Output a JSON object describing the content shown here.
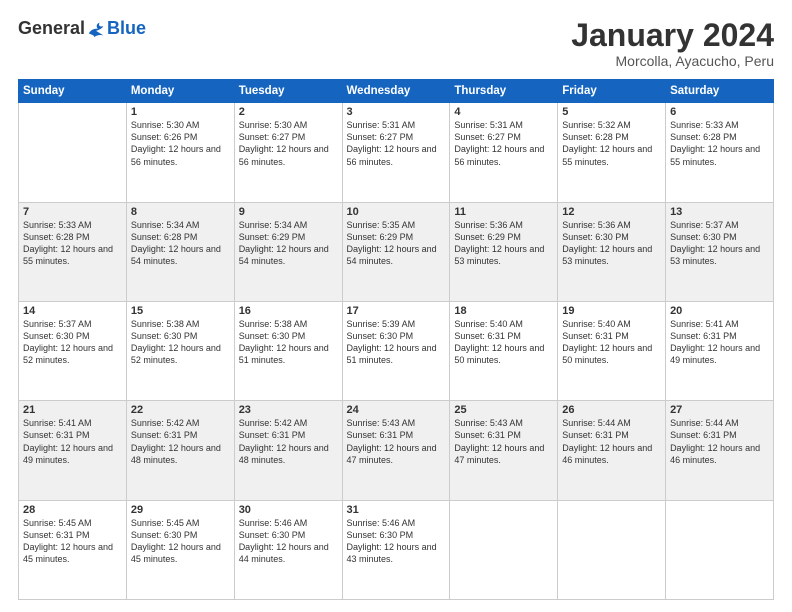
{
  "logo": {
    "general": "General",
    "blue": "Blue"
  },
  "header": {
    "title": "January 2024",
    "subtitle": "Morcolla, Ayacucho, Peru"
  },
  "weekdays": [
    "Sunday",
    "Monday",
    "Tuesday",
    "Wednesday",
    "Thursday",
    "Friday",
    "Saturday"
  ],
  "weeks": [
    [
      {
        "day": "",
        "sunrise": "",
        "sunset": "",
        "daylight": ""
      },
      {
        "day": "1",
        "sunrise": "Sunrise: 5:30 AM",
        "sunset": "Sunset: 6:26 PM",
        "daylight": "Daylight: 12 hours and 56 minutes."
      },
      {
        "day": "2",
        "sunrise": "Sunrise: 5:30 AM",
        "sunset": "Sunset: 6:27 PM",
        "daylight": "Daylight: 12 hours and 56 minutes."
      },
      {
        "day": "3",
        "sunrise": "Sunrise: 5:31 AM",
        "sunset": "Sunset: 6:27 PM",
        "daylight": "Daylight: 12 hours and 56 minutes."
      },
      {
        "day": "4",
        "sunrise": "Sunrise: 5:31 AM",
        "sunset": "Sunset: 6:27 PM",
        "daylight": "Daylight: 12 hours and 56 minutes."
      },
      {
        "day": "5",
        "sunrise": "Sunrise: 5:32 AM",
        "sunset": "Sunset: 6:28 PM",
        "daylight": "Daylight: 12 hours and 55 minutes."
      },
      {
        "day": "6",
        "sunrise": "Sunrise: 5:33 AM",
        "sunset": "Sunset: 6:28 PM",
        "daylight": "Daylight: 12 hours and 55 minutes."
      }
    ],
    [
      {
        "day": "7",
        "sunrise": "Sunrise: 5:33 AM",
        "sunset": "Sunset: 6:28 PM",
        "daylight": "Daylight: 12 hours and 55 minutes."
      },
      {
        "day": "8",
        "sunrise": "Sunrise: 5:34 AM",
        "sunset": "Sunset: 6:28 PM",
        "daylight": "Daylight: 12 hours and 54 minutes."
      },
      {
        "day": "9",
        "sunrise": "Sunrise: 5:34 AM",
        "sunset": "Sunset: 6:29 PM",
        "daylight": "Daylight: 12 hours and 54 minutes."
      },
      {
        "day": "10",
        "sunrise": "Sunrise: 5:35 AM",
        "sunset": "Sunset: 6:29 PM",
        "daylight": "Daylight: 12 hours and 54 minutes."
      },
      {
        "day": "11",
        "sunrise": "Sunrise: 5:36 AM",
        "sunset": "Sunset: 6:29 PM",
        "daylight": "Daylight: 12 hours and 53 minutes."
      },
      {
        "day": "12",
        "sunrise": "Sunrise: 5:36 AM",
        "sunset": "Sunset: 6:30 PM",
        "daylight": "Daylight: 12 hours and 53 minutes."
      },
      {
        "day": "13",
        "sunrise": "Sunrise: 5:37 AM",
        "sunset": "Sunset: 6:30 PM",
        "daylight": "Daylight: 12 hours and 53 minutes."
      }
    ],
    [
      {
        "day": "14",
        "sunrise": "Sunrise: 5:37 AM",
        "sunset": "Sunset: 6:30 PM",
        "daylight": "Daylight: 12 hours and 52 minutes."
      },
      {
        "day": "15",
        "sunrise": "Sunrise: 5:38 AM",
        "sunset": "Sunset: 6:30 PM",
        "daylight": "Daylight: 12 hours and 52 minutes."
      },
      {
        "day": "16",
        "sunrise": "Sunrise: 5:38 AM",
        "sunset": "Sunset: 6:30 PM",
        "daylight": "Daylight: 12 hours and 51 minutes."
      },
      {
        "day": "17",
        "sunrise": "Sunrise: 5:39 AM",
        "sunset": "Sunset: 6:30 PM",
        "daylight": "Daylight: 12 hours and 51 minutes."
      },
      {
        "day": "18",
        "sunrise": "Sunrise: 5:40 AM",
        "sunset": "Sunset: 6:31 PM",
        "daylight": "Daylight: 12 hours and 50 minutes."
      },
      {
        "day": "19",
        "sunrise": "Sunrise: 5:40 AM",
        "sunset": "Sunset: 6:31 PM",
        "daylight": "Daylight: 12 hours and 50 minutes."
      },
      {
        "day": "20",
        "sunrise": "Sunrise: 5:41 AM",
        "sunset": "Sunset: 6:31 PM",
        "daylight": "Daylight: 12 hours and 49 minutes."
      }
    ],
    [
      {
        "day": "21",
        "sunrise": "Sunrise: 5:41 AM",
        "sunset": "Sunset: 6:31 PM",
        "daylight": "Daylight: 12 hours and 49 minutes."
      },
      {
        "day": "22",
        "sunrise": "Sunrise: 5:42 AM",
        "sunset": "Sunset: 6:31 PM",
        "daylight": "Daylight: 12 hours and 48 minutes."
      },
      {
        "day": "23",
        "sunrise": "Sunrise: 5:42 AM",
        "sunset": "Sunset: 6:31 PM",
        "daylight": "Daylight: 12 hours and 48 minutes."
      },
      {
        "day": "24",
        "sunrise": "Sunrise: 5:43 AM",
        "sunset": "Sunset: 6:31 PM",
        "daylight": "Daylight: 12 hours and 47 minutes."
      },
      {
        "day": "25",
        "sunrise": "Sunrise: 5:43 AM",
        "sunset": "Sunset: 6:31 PM",
        "daylight": "Daylight: 12 hours and 47 minutes."
      },
      {
        "day": "26",
        "sunrise": "Sunrise: 5:44 AM",
        "sunset": "Sunset: 6:31 PM",
        "daylight": "Daylight: 12 hours and 46 minutes."
      },
      {
        "day": "27",
        "sunrise": "Sunrise: 5:44 AM",
        "sunset": "Sunset: 6:31 PM",
        "daylight": "Daylight: 12 hours and 46 minutes."
      }
    ],
    [
      {
        "day": "28",
        "sunrise": "Sunrise: 5:45 AM",
        "sunset": "Sunset: 6:31 PM",
        "daylight": "Daylight: 12 hours and 45 minutes."
      },
      {
        "day": "29",
        "sunrise": "Sunrise: 5:45 AM",
        "sunset": "Sunset: 6:30 PM",
        "daylight": "Daylight: 12 hours and 45 minutes."
      },
      {
        "day": "30",
        "sunrise": "Sunrise: 5:46 AM",
        "sunset": "Sunset: 6:30 PM",
        "daylight": "Daylight: 12 hours and 44 minutes."
      },
      {
        "day": "31",
        "sunrise": "Sunrise: 5:46 AM",
        "sunset": "Sunset: 6:30 PM",
        "daylight": "Daylight: 12 hours and 43 minutes."
      },
      {
        "day": "",
        "sunrise": "",
        "sunset": "",
        "daylight": ""
      },
      {
        "day": "",
        "sunrise": "",
        "sunset": "",
        "daylight": ""
      },
      {
        "day": "",
        "sunrise": "",
        "sunset": "",
        "daylight": ""
      }
    ]
  ]
}
